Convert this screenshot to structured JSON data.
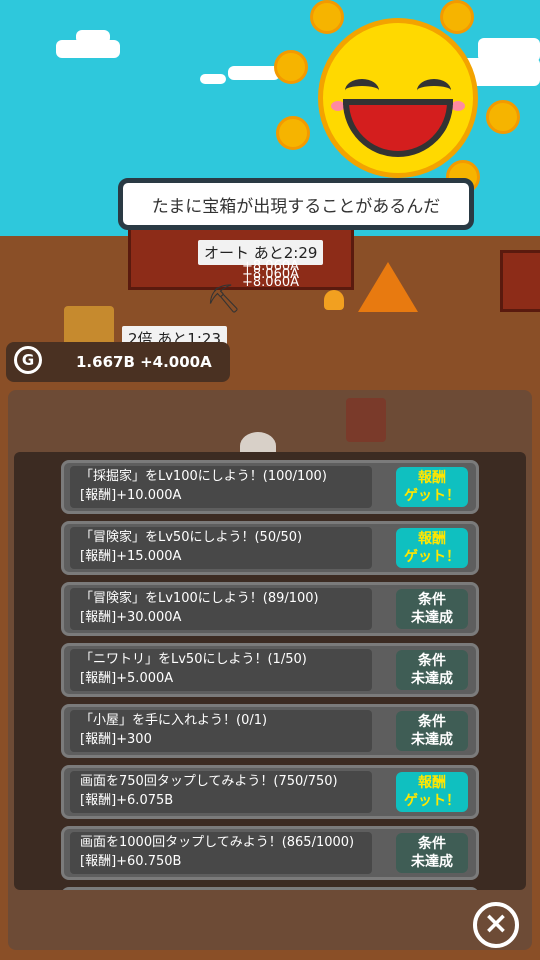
{
  "speech_bubble": "たまに宝箱が出現することがあるんだ",
  "auto_timer": "オート あと2:29",
  "floating_values": [
    "+8.060A",
    "+8.060A",
    "+8.060A"
  ],
  "double_timer": "2倍 あと1:23",
  "gold": {
    "icon": "G",
    "value": "1.667B +4.000A"
  },
  "quests": [
    {
      "title": "「採掘家」をLv100にしよう！(100/100)",
      "reward": "[報酬]+10.000A",
      "status": "reward",
      "button": [
        "報酬",
        "ゲット！"
      ]
    },
    {
      "title": "「冒険家」をLv50にしよう！(50/50)",
      "reward": "[報酬]+15.000A",
      "status": "reward",
      "button": [
        "報酬",
        "ゲット！"
      ]
    },
    {
      "title": "「冒険家」をLv100にしよう！(89/100)",
      "reward": "[報酬]+30.000A",
      "status": "locked",
      "button": [
        "条件",
        "未達成"
      ]
    },
    {
      "title": "「ニワトリ」をLv50にしよう！(1/50)",
      "reward": "[報酬]+5.000A",
      "status": "locked",
      "button": [
        "条件",
        "未達成"
      ]
    },
    {
      "title": "「小屋」を手に入れよう！(0/1)",
      "reward": "[報酬]+300",
      "status": "locked",
      "button": [
        "条件",
        "未達成"
      ]
    },
    {
      "title": "画面を750回タップしてみよう！(750/750)",
      "reward": "[報酬]+6.075B",
      "status": "reward",
      "button": [
        "報酬",
        "ゲット！"
      ]
    },
    {
      "title": "画面を1000回タップしてみよう！(865/1000)",
      "reward": "[報酬]+60.750B",
      "status": "locked",
      "button": [
        "条件",
        "未達成"
      ]
    }
  ],
  "close_icon": "close-icon",
  "colors": {
    "sky": "#2ec8dc",
    "reward_button": "#0fc0c0",
    "locked_button": "#3f5d55",
    "reward_text": "#ffe600"
  }
}
